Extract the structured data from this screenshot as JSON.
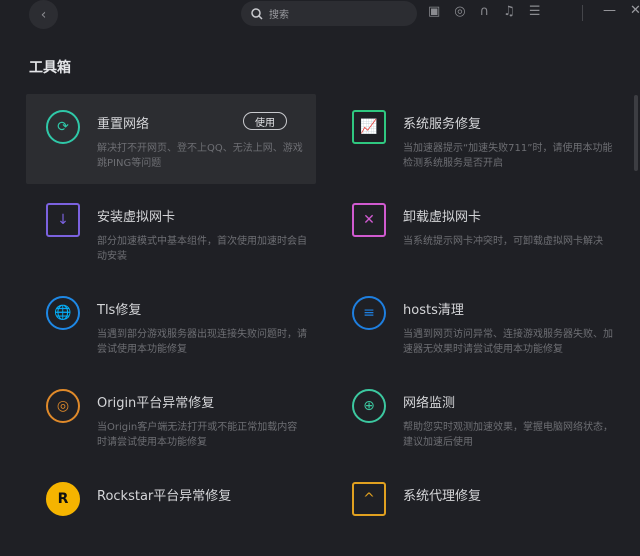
{
  "header": {
    "back_label": "‹",
    "search_placeholder": "搜索",
    "minimize": "—",
    "close": "✕"
  },
  "title": "工具箱",
  "tools": [
    {
      "title": "重置网络",
      "desc": "解决打不开网页、登不上QQ、无法上网、游戏跳PING等问题",
      "button": "使用",
      "color": "#2fc8a8"
    },
    {
      "title": "系统服务修复",
      "desc": "当加速器提示“加速失败711”时，请使用本功能检测系统服务是否开启",
      "color": "#2fc880"
    },
    {
      "title": "安装虚拟网卡",
      "desc": "部分加速模式中基本组件，首次使用加速时会自动安装",
      "color": "#7b62e0"
    },
    {
      "title": "卸载虚拟网卡",
      "desc": "当系统提示网卡冲突时，可卸载虚拟网卡解决",
      "color": "#d05ad0"
    },
    {
      "title": "Tls修复",
      "desc": "当遇到部分游戏服务器出现连接失败问题时，请尝试使用本功能修复",
      "color": "#1e88e5"
    },
    {
      "title": "hosts清理",
      "desc": "当遇到网页访问异常、连接游戏服务器失败、加速器无效果时请尝试使用本功能修复",
      "color": "#1e7fe0"
    },
    {
      "title": "Origin平台异常修复",
      "desc": "当Origin客户端无法打开或不能正常加载内容时请尝试使用本功能修复",
      "color": "#e08a2a"
    },
    {
      "title": "网络监测",
      "desc": "帮助您实时观测加速效果，掌握电脑网络状态，建议加速后使用",
      "color": "#3cc8a0"
    },
    {
      "title": "Rockstar平台异常修复",
      "desc": "",
      "color": "#f5b400"
    },
    {
      "title": "系统代理修复",
      "desc": "",
      "color": "#e0a020"
    }
  ]
}
